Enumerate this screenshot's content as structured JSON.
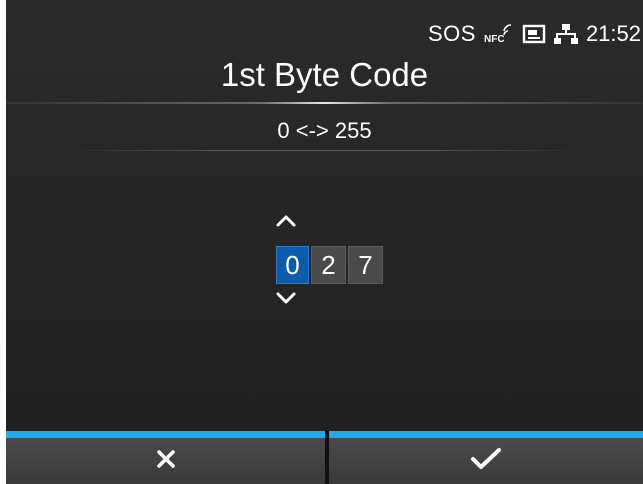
{
  "status": {
    "sos_label": "SOS",
    "time": "21:52",
    "icons": [
      "nfc-icon",
      "card-icon",
      "network-icon"
    ]
  },
  "header": {
    "title": "1st Byte Code"
  },
  "range": {
    "label": "0 <-> 255"
  },
  "editor": {
    "digits": [
      "0",
      "2",
      "7"
    ],
    "selected_index": 0
  },
  "footer": {
    "cancel_icon": "close-icon",
    "ok_icon": "check-icon"
  },
  "colors": {
    "accent": "#21a9ee",
    "selected_digit": "#0d5cab",
    "background": "#262626"
  }
}
